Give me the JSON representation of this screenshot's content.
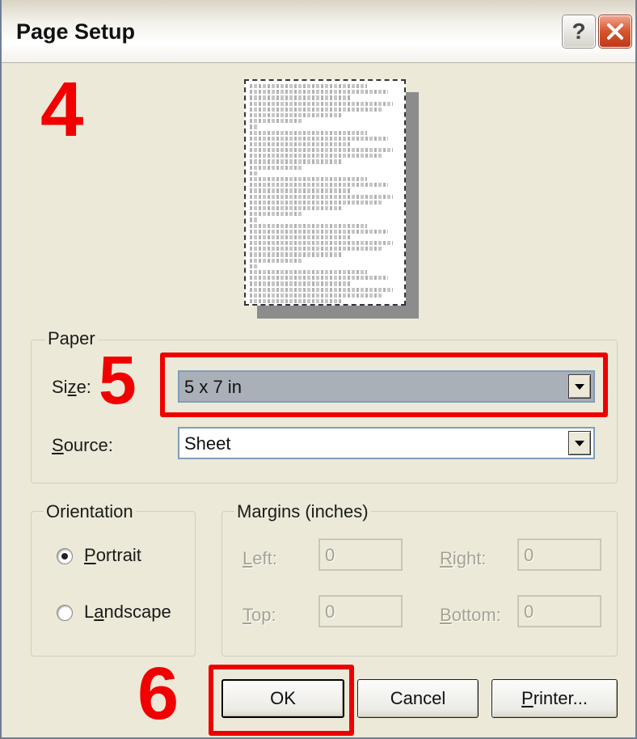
{
  "window": {
    "title": "Page Setup",
    "help_label": "?"
  },
  "steps": {
    "four": "4",
    "five": "5",
    "six": "6"
  },
  "preview": {
    "line_count": 38
  },
  "paper": {
    "group_label": "Paper",
    "size_label_prefix": "Si",
    "size_label_ul": "z",
    "size_label_suffix": "e:",
    "size_value": "5 x 7 in",
    "source_label_ul": "S",
    "source_label_suffix": "ource:",
    "source_value": "Sheet"
  },
  "orientation": {
    "group_label": "Orientation",
    "portrait_ul": "P",
    "portrait_rest": "ortrait",
    "landscape_prefix": "L",
    "landscape_ul": "a",
    "landscape_rest": "ndscape",
    "selected": "portrait"
  },
  "margins": {
    "group_label": "Margins (inches)",
    "left_ul": "L",
    "left_rest": "eft:",
    "right_ul": "R",
    "right_rest": "ight:",
    "top_ul": "T",
    "top_rest": "op:",
    "bottom_ul": "B",
    "bottom_rest": "ottom:",
    "left_value": "0",
    "right_value": "0",
    "top_value": "0",
    "bottom_value": "0"
  },
  "buttons": {
    "ok": "OK",
    "cancel": "Cancel",
    "printer_ul": "P",
    "printer_rest": "rinter..."
  },
  "colors": {
    "highlight_red": "#ee0000",
    "dialog_bg": "#ece9d8"
  }
}
